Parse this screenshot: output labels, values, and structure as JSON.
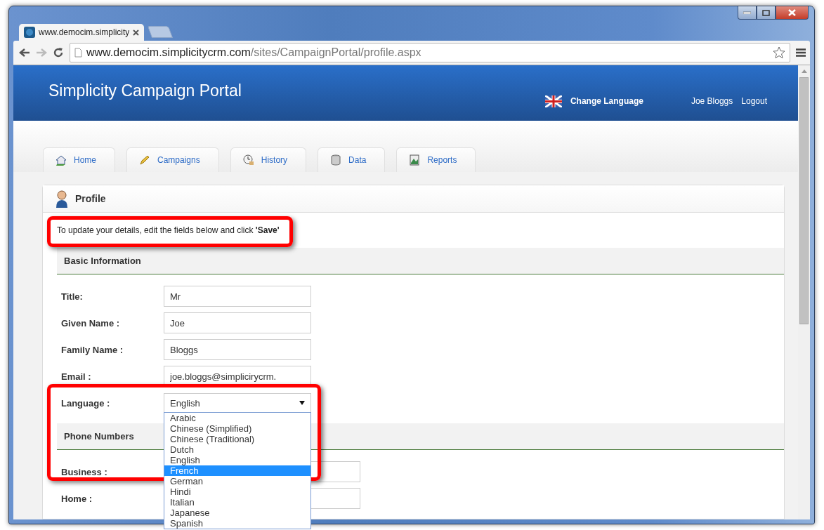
{
  "browser": {
    "tab_title": "www.democim.simplicity",
    "url_host": "www.democim.simplicitycrm.com",
    "url_path": "/sites/CampaignPortal/profile.aspx"
  },
  "header": {
    "title": "Simplicity Campaign Portal",
    "change_language": "Change Language",
    "user": "Joe Bloggs",
    "logout": "Logout"
  },
  "nav_tabs": [
    {
      "label": "Home"
    },
    {
      "label": "Campaigns"
    },
    {
      "label": "History"
    },
    {
      "label": "Data"
    },
    {
      "label": "Reports"
    }
  ],
  "panel": {
    "title": "Profile",
    "instruction": "To update your details, edit the fields below and click **'Save'**"
  },
  "sections": [
    {
      "title": "Basic Information",
      "fields": [
        {
          "kind": "text",
          "label": "Title:",
          "value": "Mr"
        },
        {
          "kind": "text",
          "label": "Given Name :",
          "value": "Joe"
        },
        {
          "kind": "text",
          "label": "Family Name :",
          "value": "Bloggs"
        },
        {
          "kind": "text",
          "label": "Email :",
          "value": "joe.bloggs@simplicirycrm."
        },
        {
          "kind": "select",
          "label": "Language :",
          "value": "English",
          "expanded": true,
          "options": [
            {
              "label": "Arabic",
              "highlighted": false
            },
            {
              "label": "Chinese (Simplified)",
              "highlighted": false
            },
            {
              "label": "Chinese (Traditional)",
              "highlighted": false
            },
            {
              "label": "Dutch",
              "highlighted": false
            },
            {
              "label": "English",
              "highlighted": false
            },
            {
              "label": "French",
              "highlighted": true
            },
            {
              "label": "German",
              "highlighted": false
            },
            {
              "label": "Hindi",
              "highlighted": false
            },
            {
              "label": "Italian",
              "highlighted": false
            },
            {
              "label": "Japanese",
              "highlighted": false
            },
            {
              "label": "Spanish",
              "highlighted": false
            }
          ]
        }
      ]
    },
    {
      "title": "Phone Numbers",
      "fields": [
        {
          "kind": "wide",
          "label": "Business :"
        },
        {
          "kind": "wide",
          "label": "Home :"
        }
      ]
    }
  ]
}
